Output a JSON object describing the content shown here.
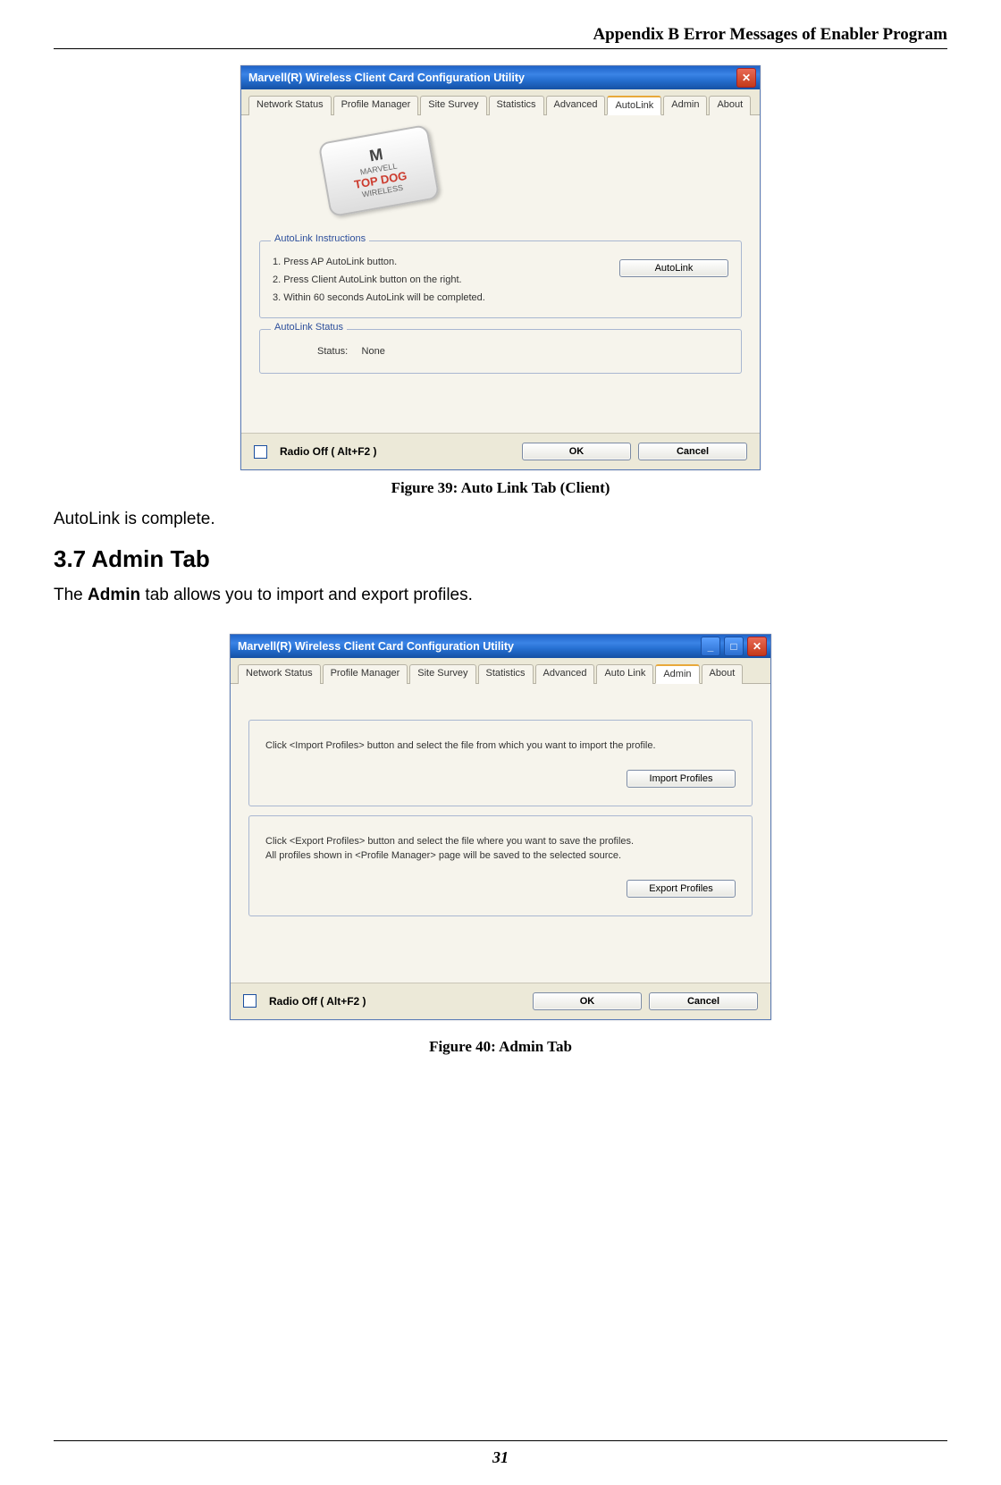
{
  "header": {
    "title": "Appendix B Error Messages of Enabler Program"
  },
  "fig39": {
    "window_title": "Marvell(R) Wireless Client Card Configuration Utility",
    "tabs": [
      "Network Status",
      "Profile Manager",
      "Site Survey",
      "Statistics",
      "Advanced",
      "AutoLink",
      "Admin",
      "About"
    ],
    "active_tab": "AutoLink",
    "logo_top": "MARVELL",
    "logo_mid": "TOP DOG",
    "logo_bot": "WIRELESS",
    "group1_title": "AutoLink Instructions",
    "instructions": [
      "1. Press AP AutoLink button.",
      "2. Press Client AutoLink button on the right.",
      "3. Within 60 seconds AutoLink will be completed."
    ],
    "autolink_btn": "AutoLink",
    "group2_title": "AutoLink Status",
    "status_label": "Status:",
    "status_value": "None",
    "radio_off": "Radio Off  ( Alt+F2 )",
    "ok": "OK",
    "cancel": "Cancel",
    "caption": "Figure 39: Auto Link Tab (Client)"
  },
  "text1": "AutoLink is complete.",
  "section_heading": "3.7 Admin Tab",
  "text2_pre": "The ",
  "text2_bold": "Admin",
  "text2_post": " tab allows you to import and export profiles.",
  "fig40": {
    "window_title": "Marvell(R) Wireless Client Card Configuration Utility",
    "tabs": [
      "Network Status",
      "Profile Manager",
      "Site Survey",
      "Statistics",
      "Advanced",
      "Auto Link",
      "Admin",
      "About"
    ],
    "active_tab": "Admin",
    "import_text": "Click <Import Profiles> button and select the file from which you want to import the profile.",
    "import_btn": "Import Profiles",
    "export_text1": "Click <Export Profiles> button and select the file where you want to save the profiles.",
    "export_text2": "All profiles shown in <Profile Manager> page will be saved to the selected source.",
    "export_btn": "Export Profiles",
    "radio_off": "Radio Off  ( Alt+F2 )",
    "ok": "OK",
    "cancel": "Cancel",
    "caption": "Figure 40: Admin Tab"
  },
  "page_number": "31"
}
